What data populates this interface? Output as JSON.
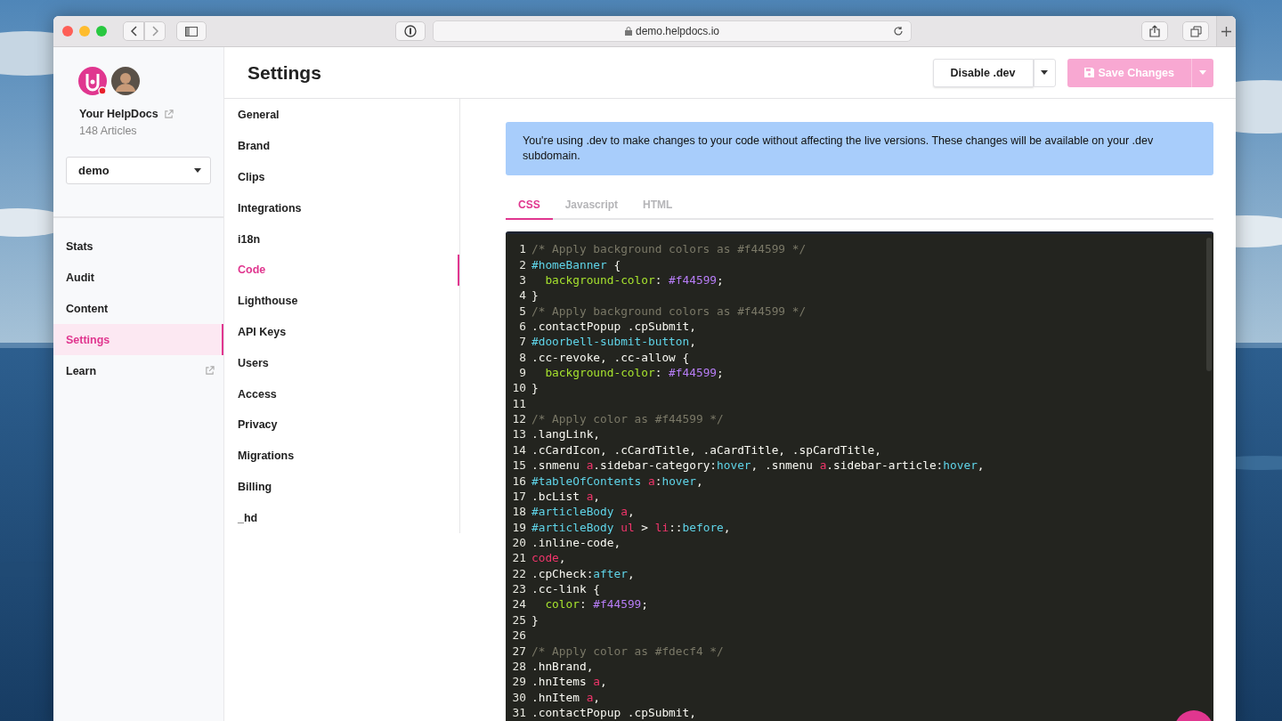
{
  "browser": {
    "url": "demo.helpdocs.io"
  },
  "sidebar": {
    "site_name": "Your HelpDocs",
    "article_count": "148 Articles",
    "workspace_select": {
      "value": "demo"
    },
    "items": [
      {
        "label": "Stats",
        "selected": false,
        "external": false
      },
      {
        "label": "Audit",
        "selected": false,
        "external": false
      },
      {
        "label": "Content",
        "selected": false,
        "external": false
      },
      {
        "label": "Settings",
        "selected": true,
        "external": false
      },
      {
        "label": "Learn",
        "selected": false,
        "external": true
      }
    ]
  },
  "header": {
    "title": "Settings",
    "buttons": [
      {
        "label": "Disable .dev",
        "kind": "secondary",
        "disabled": false
      },
      {
        "label": "Save Changes",
        "kind": "primary",
        "disabled": true
      }
    ]
  },
  "settings_nav": {
    "items": [
      {
        "label": "General",
        "selected": false
      },
      {
        "label": "Brand",
        "selected": false
      },
      {
        "label": "Clips",
        "selected": false
      },
      {
        "label": "Integrations",
        "selected": false
      },
      {
        "label": "i18n",
        "selected": false
      },
      {
        "label": "Code",
        "selected": true
      },
      {
        "label": "Lighthouse",
        "selected": false
      },
      {
        "label": "API Keys",
        "selected": false
      },
      {
        "label": "Users",
        "selected": false
      },
      {
        "label": "Access",
        "selected": false
      },
      {
        "label": "Privacy",
        "selected": false
      },
      {
        "label": "Migrations",
        "selected": false
      },
      {
        "label": "Billing",
        "selected": false
      },
      {
        "label": "_hd",
        "selected": false
      }
    ]
  },
  "notice": {
    "text": "You're using .dev to make changes to your code without affecting the live versions. These changes will be available on your .dev subdomain."
  },
  "code_tabs": [
    {
      "label": "CSS",
      "selected": true
    },
    {
      "label": "Javascript",
      "selected": false
    },
    {
      "label": "HTML",
      "selected": false
    }
  ],
  "editor": {
    "lines": [
      {
        "number": "1",
        "tokens": [
          {
            "kind": "comment",
            "text": "/* Apply background colors as #f44599 */"
          }
        ]
      },
      {
        "number": "2",
        "tokens": [
          {
            "kind": "id",
            "text": "#homeBanner"
          },
          {
            "kind": "plain",
            "text": " {"
          }
        ]
      },
      {
        "number": "3",
        "indented": true,
        "tokens": [
          {
            "kind": "property",
            "text": "background-color"
          },
          {
            "kind": "plain",
            "text": ": "
          },
          {
            "kind": "value",
            "text": "#f44599"
          },
          {
            "kind": "plain",
            "text": ";"
          }
        ]
      },
      {
        "number": "4",
        "tokens": [
          {
            "kind": "plain",
            "text": "}"
          }
        ]
      },
      {
        "number": "5",
        "tokens": [
          {
            "kind": "comment",
            "text": "/* Apply background colors as #f44599 */"
          }
        ]
      },
      {
        "number": "6",
        "tokens": [
          {
            "kind": "plain",
            "text": ".contactPopup .cpSubmit,"
          }
        ]
      },
      {
        "number": "7",
        "tokens": [
          {
            "kind": "id",
            "text": "#doorbell-submit-button"
          },
          {
            "kind": "plain",
            "text": ","
          }
        ]
      },
      {
        "number": "8",
        "tokens": [
          {
            "kind": "plain",
            "text": ".cc-revoke, .cc-allow {"
          }
        ]
      },
      {
        "number": "9",
        "indented": true,
        "tokens": [
          {
            "kind": "property",
            "text": "background-color"
          },
          {
            "kind": "plain",
            "text": ": "
          },
          {
            "kind": "value",
            "text": "#f44599"
          },
          {
            "kind": "plain",
            "text": ";"
          }
        ]
      },
      {
        "number": "10",
        "tokens": [
          {
            "kind": "plain",
            "text": "}"
          }
        ]
      },
      {
        "number": "11"
      },
      {
        "number": "12",
        "tokens": [
          {
            "kind": "comment",
            "text": "/* Apply color as #f44599 */"
          }
        ]
      },
      {
        "number": "13",
        "tokens": [
          {
            "kind": "plain",
            "text": ".langLink,"
          }
        ]
      },
      {
        "number": "14",
        "tokens": [
          {
            "kind": "plain",
            "text": ".cCardIcon, .cCardTitle, .aCardTitle, .spCardTitle,"
          }
        ]
      },
      {
        "number": "15",
        "tokens": [
          {
            "kind": "plain",
            "text": ".snmenu "
          },
          {
            "kind": "tag",
            "text": "a"
          },
          {
            "kind": "plain",
            "text": ".sidebar-category:"
          },
          {
            "kind": "pseudo",
            "text": "hover"
          },
          {
            "kind": "plain",
            "text": ", .snmenu "
          },
          {
            "kind": "tag",
            "text": "a"
          },
          {
            "kind": "plain",
            "text": ".sidebar-article:"
          },
          {
            "kind": "pseudo",
            "text": "hover"
          },
          {
            "kind": "plain",
            "text": ","
          }
        ]
      },
      {
        "number": "16",
        "tokens": [
          {
            "kind": "id",
            "text": "#tableOfContents "
          },
          {
            "kind": "tag",
            "text": "a"
          },
          {
            "kind": "plain",
            "text": ":"
          },
          {
            "kind": "pseudo",
            "text": "hover"
          },
          {
            "kind": "plain",
            "text": ","
          }
        ]
      },
      {
        "number": "17",
        "tokens": [
          {
            "kind": "plain",
            "text": ".bcList "
          },
          {
            "kind": "tag",
            "text": "a"
          },
          {
            "kind": "plain",
            "text": ","
          }
        ]
      },
      {
        "number": "18",
        "tokens": [
          {
            "kind": "id",
            "text": "#articleBody "
          },
          {
            "kind": "tag",
            "text": "a"
          },
          {
            "kind": "plain",
            "text": ","
          }
        ]
      },
      {
        "number": "19",
        "tokens": [
          {
            "kind": "id",
            "text": "#articleBody "
          },
          {
            "kind": "tag",
            "text": "ul"
          },
          {
            "kind": "plain",
            "text": " > "
          },
          {
            "kind": "tag",
            "text": "li"
          },
          {
            "kind": "plain",
            "text": "::"
          },
          {
            "kind": "pseudo",
            "text": "before"
          },
          {
            "kind": "plain",
            "text": ","
          }
        ]
      },
      {
        "number": "20",
        "tokens": [
          {
            "kind": "plain",
            "text": ".inline-code,"
          }
        ]
      },
      {
        "number": "21",
        "tokens": [
          {
            "kind": "tag",
            "text": "code"
          },
          {
            "kind": "plain",
            "text": ","
          }
        ]
      },
      {
        "number": "22",
        "tokens": [
          {
            "kind": "plain",
            "text": ".cpCheck:"
          },
          {
            "kind": "pseudo",
            "text": "after"
          },
          {
            "kind": "plain",
            "text": ","
          }
        ]
      },
      {
        "number": "23",
        "tokens": [
          {
            "kind": "plain",
            "text": ".cc-link {"
          }
        ]
      },
      {
        "number": "24",
        "indented": true,
        "tokens": [
          {
            "kind": "property",
            "text": "color"
          },
          {
            "kind": "plain",
            "text": ": "
          },
          {
            "kind": "value",
            "text": "#f44599"
          },
          {
            "kind": "plain",
            "text": ";"
          }
        ]
      },
      {
        "number": "25",
        "tokens": [
          {
            "kind": "plain",
            "text": "}"
          }
        ]
      },
      {
        "number": "26"
      },
      {
        "number": "27",
        "tokens": [
          {
            "kind": "comment",
            "text": "/* Apply color as #fdecf4 */"
          }
        ]
      },
      {
        "number": "28",
        "tokens": [
          {
            "kind": "plain",
            "text": ".hnBrand,"
          }
        ]
      },
      {
        "number": "29",
        "tokens": [
          {
            "kind": "plain",
            "text": ".hnItems "
          },
          {
            "kind": "tag",
            "text": "a"
          },
          {
            "kind": "plain",
            "text": ","
          }
        ]
      },
      {
        "number": "30",
        "tokens": [
          {
            "kind": "plain",
            "text": ".hnItem "
          },
          {
            "kind": "tag",
            "text": "a"
          },
          {
            "kind": "plain",
            "text": ","
          }
        ]
      },
      {
        "number": "31",
        "tokens": [
          {
            "kind": "plain",
            "text": ".contactPopup .cpSubmit,"
          }
        ]
      }
    ]
  }
}
